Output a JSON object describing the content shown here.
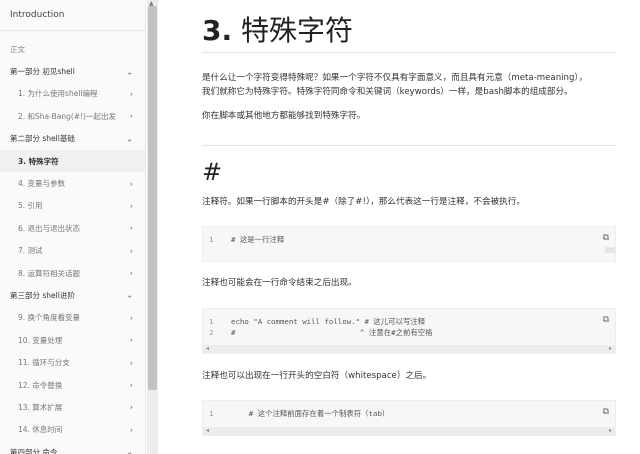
{
  "sidebar": {
    "header": "Introduction",
    "items": [
      {
        "label": "正文",
        "type": "preface"
      },
      {
        "label": "第一部分 初见shell",
        "type": "part"
      },
      {
        "label": "1. 为什么使用shell编程",
        "type": "chapter"
      },
      {
        "label": "2. 和Sha-Bang(#!)一起出发",
        "type": "chapter"
      },
      {
        "label": "第二部分 shell基础",
        "type": "part"
      },
      {
        "label": "3. 特殊字符",
        "type": "chapter-active"
      },
      {
        "label": "4. 变量与参数",
        "type": "chapter"
      },
      {
        "label": "5. 引用",
        "type": "chapter"
      },
      {
        "label": "6. 退出与退出状态",
        "type": "chapter"
      },
      {
        "label": "7. 测试",
        "type": "chapter"
      },
      {
        "label": "8. 运算符相关话题",
        "type": "chapter"
      },
      {
        "label": "第三部分 shell进阶",
        "type": "part"
      },
      {
        "label": "9. 换个角度看变量",
        "type": "chapter"
      },
      {
        "label": "10. 变量处理",
        "type": "chapter"
      },
      {
        "label": "11. 循环与分支",
        "type": "chapter"
      },
      {
        "label": "12. 命令替换",
        "type": "chapter"
      },
      {
        "label": "13. 算术扩展",
        "type": "chapter"
      },
      {
        "label": "14. 休息时间",
        "type": "chapter"
      },
      {
        "label": "第四部分 命令",
        "type": "part"
      }
    ]
  },
  "main": {
    "title_num": "3.",
    "title_text": "特殊字符",
    "intro_line1": "是什么让一个字符变得特殊呢？如果一个字符不仅具有字面意义，而且具有元意（meta-meaning），",
    "intro_line2": "我们就称它为特殊字符。特殊字符同命令和关键词（keywords）一样，是bash脚本的组成部分。",
    "intro_line3": "你在脚本或其他地方都能够找到特殊字符。",
    "section_heading": "#",
    "comment_desc": "注释符。如果一行脚本的开头是#（除了#!），那么代表这一行是注释，不会被执行。",
    "code1": [
      {
        "ln": "1",
        "text": "# 这是一行注释"
      }
    ],
    "after_cmd_desc": "注释也可能会在一行命令结束之后出现。",
    "code2": [
      {
        "ln": "1",
        "text": "echo \"A comment will follow.\" # 这儿可以写注释"
      },
      {
        "ln": "2",
        "text": "#                            ^ 注意在#之前有空格"
      }
    ],
    "whitespace_desc": "注释也可以出现在一行开头的空白符（whitespace）之后。",
    "code3": [
      {
        "ln": "1",
        "text": "    # 这个注释前面存在着一个制表符（tab）"
      }
    ]
  }
}
